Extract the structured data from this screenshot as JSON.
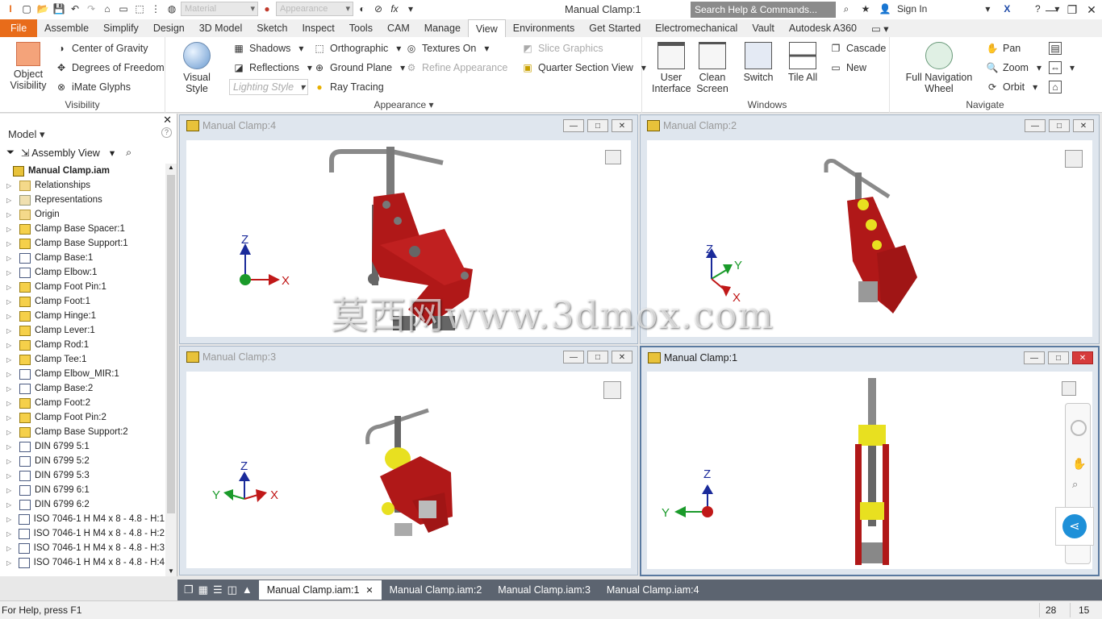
{
  "app": {
    "title": "Manual Clamp:1"
  },
  "titlebar": {
    "material_combo": "Material",
    "appearance_combo": "Appearance",
    "search_placeholder": "Search Help & Commands...",
    "sign_in": "Sign In"
  },
  "ribbon_tabs": [
    "File",
    "Assemble",
    "Simplify",
    "Design",
    "3D Model",
    "Sketch",
    "Inspect",
    "Tools",
    "CAM",
    "Manage",
    "View",
    "Environments",
    "Get Started",
    "Electromechanical",
    "Vault",
    "Autodesk A360"
  ],
  "active_tab": "View",
  "ribbon": {
    "visibility": {
      "label": "Visibility",
      "object_visibility": "Object Visibility",
      "center_of_gravity": "Center of Gravity",
      "degrees_of_freedom": "Degrees of Freedom",
      "imate_glyphs": "iMate Glyphs"
    },
    "appearance": {
      "label": "Appearance",
      "visual_style": "Visual Style",
      "shadows": "Shadows",
      "reflections": "Reflections",
      "lighting_style": "Lighting Style",
      "orthographic": "Orthographic",
      "ground_plane": "Ground Plane",
      "ray_tracing": "Ray Tracing",
      "textures_on": "Textures On",
      "refine_appearance": "Refine Appearance",
      "slice_graphics": "Slice Graphics",
      "quarter_section_view": "Quarter Section View"
    },
    "windows": {
      "label": "Windows",
      "user_interface": "User Interface",
      "clean_screen": "Clean Screen",
      "switch": "Switch",
      "tile_all": "Tile All",
      "cascade": "Cascade",
      "new": "New"
    },
    "navigate": {
      "label": "Navigate",
      "full_nav_wheel": "Full Navigation Wheel",
      "pan": "Pan",
      "zoom": "Zoom",
      "orbit": "Orbit"
    }
  },
  "browser": {
    "title": "Model",
    "view_mode": "Assembly View",
    "root": "Manual Clamp.iam",
    "items": [
      {
        "label": "Relationships",
        "kind": "folder"
      },
      {
        "label": "Representations",
        "kind": "repr"
      },
      {
        "label": "Origin",
        "kind": "folder"
      },
      {
        "label": "Clamp Base Spacer:1",
        "kind": "part"
      },
      {
        "label": "Clamp Base Support:1",
        "kind": "part"
      },
      {
        "label": "Clamp Base:1",
        "kind": "cc"
      },
      {
        "label": "Clamp Elbow:1",
        "kind": "cc"
      },
      {
        "label": "Clamp Foot Pin:1",
        "kind": "part"
      },
      {
        "label": "Clamp Foot:1",
        "kind": "part"
      },
      {
        "label": "Clamp Hinge:1",
        "kind": "part"
      },
      {
        "label": "Clamp Lever:1",
        "kind": "part"
      },
      {
        "label": "Clamp Rod:1",
        "kind": "part"
      },
      {
        "label": "Clamp Tee:1",
        "kind": "part"
      },
      {
        "label": "Clamp Elbow_MIR:1",
        "kind": "cc"
      },
      {
        "label": "Clamp Base:2",
        "kind": "cc"
      },
      {
        "label": "Clamp Foot:2",
        "kind": "part"
      },
      {
        "label": "Clamp Foot Pin:2",
        "kind": "part"
      },
      {
        "label": "Clamp Base Support:2",
        "kind": "part"
      },
      {
        "label": "DIN 6799 5:1",
        "kind": "cc"
      },
      {
        "label": "DIN 6799 5:2",
        "kind": "cc"
      },
      {
        "label": "DIN 6799 5:3",
        "kind": "cc"
      },
      {
        "label": "DIN 6799 6:1",
        "kind": "cc"
      },
      {
        "label": "DIN 6799 6:2",
        "kind": "cc"
      },
      {
        "label": "ISO 7046-1 H M4 x 8 - 4.8 - H:1",
        "kind": "cc"
      },
      {
        "label": "ISO 7046-1 H M4 x 8 - 4.8 - H:2",
        "kind": "cc"
      },
      {
        "label": "ISO 7046-1 H M4 x 8 - 4.8 - H:3",
        "kind": "cc"
      },
      {
        "label": "ISO 7046-1 H M4 x 8 - 4.8 - H:4",
        "kind": "cc"
      }
    ]
  },
  "viewports": [
    {
      "title": "Manual Clamp:4",
      "active": false
    },
    {
      "title": "Manual Clamp:2",
      "active": false
    },
    {
      "title": "Manual Clamp:3",
      "active": false
    },
    {
      "title": "Manual Clamp:1",
      "active": true
    }
  ],
  "axes": {
    "x": "X",
    "y": "Y",
    "z": "Z"
  },
  "watermark": "莫西网www.3dmox.com",
  "doc_tabs": [
    "Manual Clamp.iam:1",
    "Manual Clamp.iam:2",
    "Manual Clamp.iam:3",
    "Manual Clamp.iam:4"
  ],
  "status": {
    "help_text": "For Help, press F1",
    "n1": "28",
    "n2": "15"
  },
  "colors": {
    "file_tab": "#e86c1a",
    "clamp_red": "#b01818",
    "clamp_yellow": "#e8e020",
    "rod_gray": "#8a8a8a",
    "axis_blue": "#1a2a9a",
    "axis_green": "#1a9a2a",
    "axis_red": "#c01818"
  }
}
